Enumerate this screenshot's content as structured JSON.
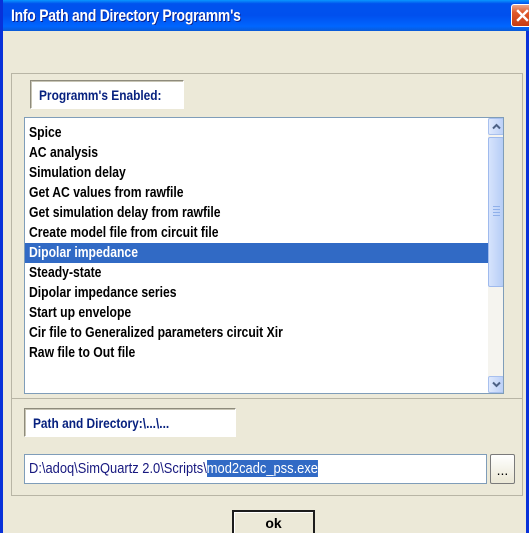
{
  "window": {
    "title": "Info Path and Directory Programm's"
  },
  "programs": {
    "label": "Programm's Enabled:",
    "items": [
      "Spice",
      "AC analysis",
      "Simulation delay",
      "Get AC values from rawfile",
      "Get simulation delay from rawfile",
      "Create model file from circuit file",
      "Dipolar impedance",
      "Steady-state",
      "Dipolar impedance series",
      "Start up envelope",
      "Cir file to Generalized parameters circuit Xir",
      "Raw file to Out file"
    ],
    "selected_item": "Dipolar impedance"
  },
  "path": {
    "label": "Path and Directory:\\...\\...",
    "value_prefix": "D:\\adoq\\SimQuartz 2.0\\Scripts\\",
    "value_selected": "mod2cadc_pss.exe",
    "browse_label": "..."
  },
  "buttons": {
    "ok_label": "ok"
  },
  "colors": {
    "selection": "#316ac5",
    "titlebar": "#0054e3",
    "dialog_bg": "#ece9d8",
    "label_text": "#07217f"
  }
}
